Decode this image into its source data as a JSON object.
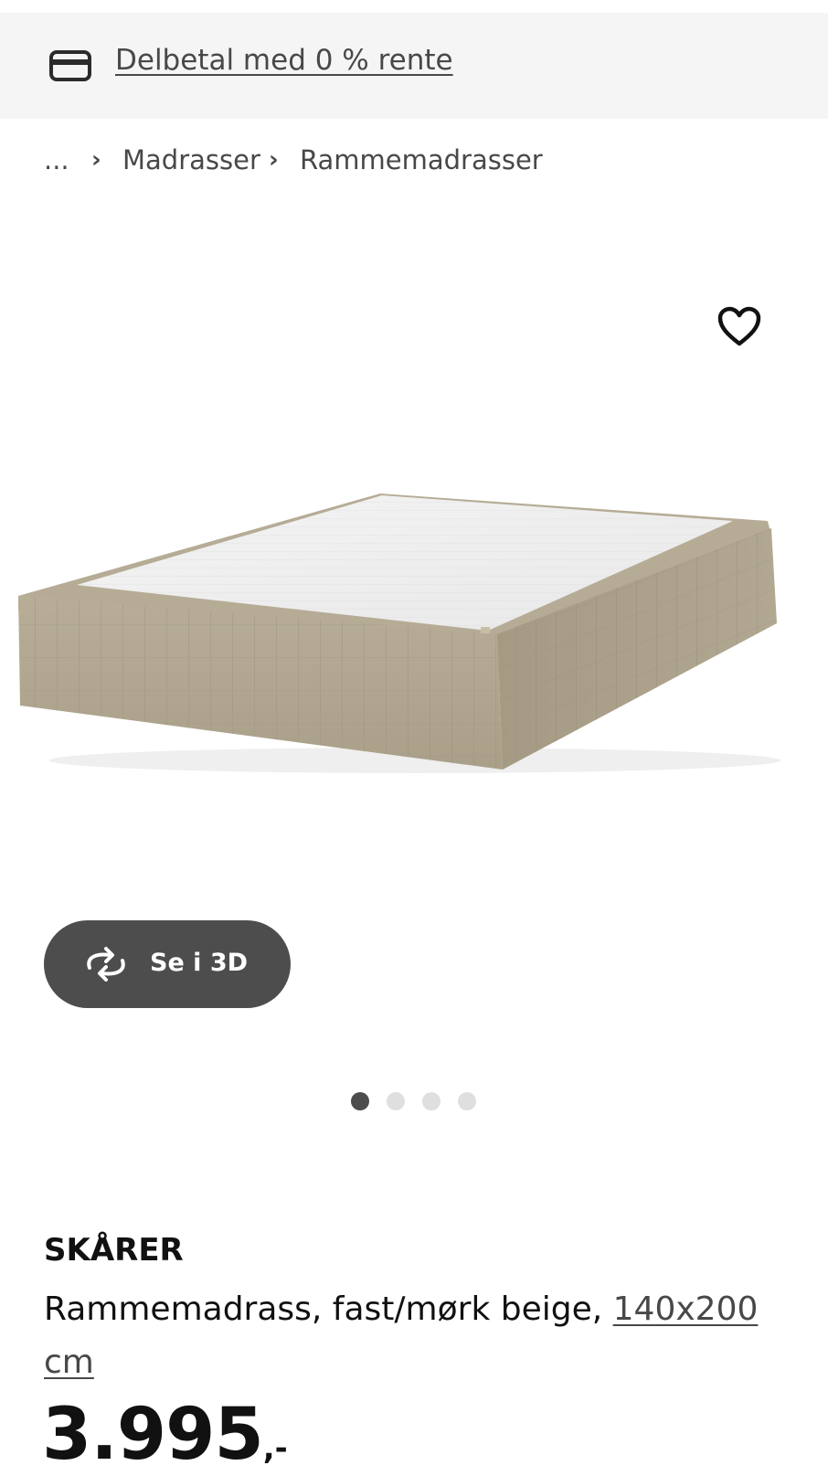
{
  "banner": {
    "icon": "credit-card-icon",
    "link_text": "Delbetal med 0 % rente"
  },
  "breadcrumb": {
    "ellipsis": "...",
    "separator": "›",
    "items": [
      "Madrasser",
      "Rammemadrasser"
    ]
  },
  "gallery": {
    "favorite_icon": "heart-icon",
    "image_alt": "product-image",
    "view_3d_icon": "rotate-3d-icon",
    "view_3d_label": "Se i 3D",
    "dot_count": 4,
    "active_dot": 1
  },
  "product": {
    "name": "SKÅRER",
    "description": "Rammemadrass, fast/mørk beige,",
    "size_link": "140x200 cm",
    "price_amount": "3.995",
    "price_suffix": ",-"
  },
  "colors": {
    "banner_bg": "#f5f5f5",
    "button_bg": "#4d4d4d",
    "dot_inactive": "#dfdfdf",
    "text": "#111111",
    "muted_text": "#484848",
    "mattress_fabric": "#b3a890"
  }
}
